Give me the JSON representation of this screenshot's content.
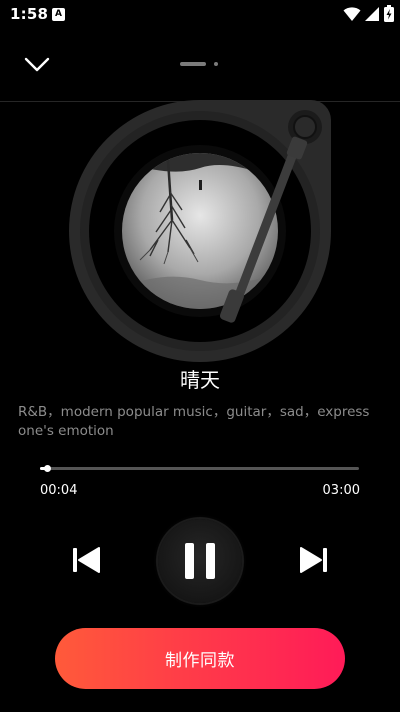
{
  "status_bar": {
    "time": "1:58",
    "notification_badge": "A",
    "icons": [
      "wifi-icon",
      "signal-icon",
      "battery-charging-icon"
    ]
  },
  "header": {
    "collapse_icon": "chevron-down-icon",
    "page_indicator": {
      "pages": 2,
      "active": 0
    }
  },
  "player": {
    "title": "晴天",
    "description": "R&B，modern popular music，guitar，sad，express one's emotion",
    "current_time": "00:04",
    "total_time": "03:00",
    "progress": 0.022,
    "state": "playing"
  },
  "controls": {
    "prev_icon": "skip-previous-icon",
    "pause_icon": "pause-icon",
    "next_icon": "skip-next-icon"
  },
  "action": {
    "make_same_label": "制作同款"
  },
  "colors": {
    "background": "#000000",
    "accent_start": "#ff5a3a",
    "accent_end": "#ff1b58",
    "muted_text": "#8c8c8c"
  }
}
